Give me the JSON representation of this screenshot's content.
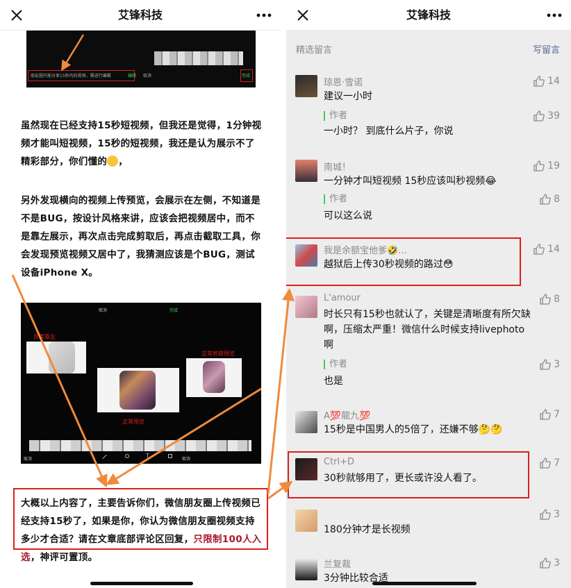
{
  "left": {
    "nav": {
      "title": "艾锋科技"
    },
    "screenshot_top": {
      "caption": "朋友圈只能分享15秒内的视频，需进行编辑",
      "pick_label": "编辑",
      "cancel_label": "取消",
      "done_label": "完成"
    },
    "para1": "虽然现在已经支持15秒短视频，但我还是觉得，1分钟视频才能叫短视频，15秒的短视频，我还是认为展示不了精彩部分，你们懂的",
    "para1_tail": "，",
    "para2": "另外发现横向的视频上传预览，会展示在左侧，不知道是不是BUG，按设计风格来讲，应该会把视频居中，而不是靠左展示，再次点击完成剪取后，再点击截取工具，你会发现预览视频又居中了，我猜测应该是个BUG，测试设备iPhone X。",
    "screenshot_mid": {
      "cancel_label": "取消",
      "done_label": "完成",
      "label_left": "异常靠左",
      "label_right": "正常剪取预览",
      "label_center": "正常预览",
      "bottom_cancel": "取消",
      "bottom_done": "取消"
    },
    "para3_main": "大概以上内容了，主要告诉你们，微信朋友圈上传视频已经支持15秒了，如果是你，你认为微信朋友圈视频支持多少才合适？请在文章底部评论区回复，",
    "para3_red": "只限制100人入选",
    "para3_tail": "，神评可置顶。"
  },
  "right": {
    "nav": {
      "title": "艾锋科技"
    },
    "section_title": "精选留言",
    "write_label": "写留言",
    "comments": [
      {
        "name": "琼恩·雪诺",
        "text": "建议一小时",
        "likes": "14",
        "reply": {
          "tag": "作者",
          "text": "一小时？ 到底什么片子，你说",
          "likes": "39"
        }
      },
      {
        "name": "南城！",
        "text": "一分钟才叫短视频 15秒应该叫秒视频😂",
        "likes": "19",
        "reply": {
          "tag": "作者",
          "text": "可以这么说",
          "likes": "8"
        }
      },
      {
        "name": "我是余额宝他爹🤣...",
        "text": "越狱后上传30秒视频的路过😳",
        "likes": "14"
      },
      {
        "name": "L'amour",
        "text": "时长只有15秒也就认了，关键是清晰度有所欠缺啊，压缩太严重！微信什么时候支持livephoto啊",
        "likes": "8",
        "reply": {
          "tag": "作者",
          "text": "也是",
          "likes": "3"
        }
      },
      {
        "name": "A💯龍九💯",
        "text": "15秒是中国男人的5倍了，还嫌不够🤔🤔",
        "likes": "7"
      },
      {
        "name": "Ctrl+D",
        "text": "30秒就够用了，更长或许没人看了。",
        "likes": "7"
      },
      {
        "name": "",
        "text": "180分钟才是长视频",
        "likes": "3"
      },
      {
        "name": "兰复裁",
        "text": "3分钟比较合适",
        "likes": "3"
      }
    ]
  },
  "colors": {
    "annotation_red": "#d8201c",
    "arrow_orange": "#f08a3c",
    "link_blue": "#576b95",
    "author_green": "#3ccf5c",
    "highlight_red": "#a8192e"
  }
}
